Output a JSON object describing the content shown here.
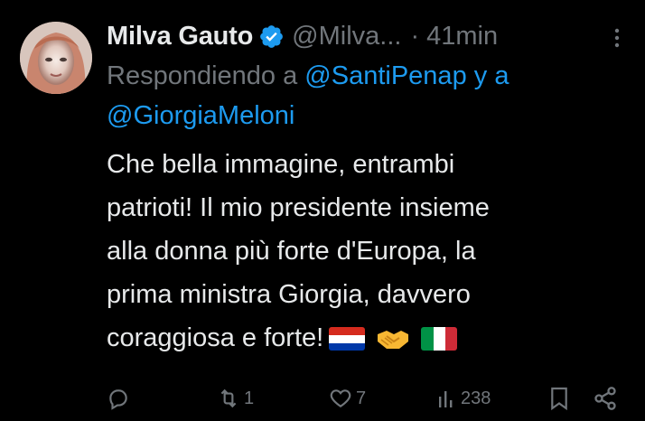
{
  "tweet": {
    "display_name": "Milva Gauto",
    "handle": "@Milva...",
    "separator": "·",
    "time": "41min",
    "replying_prefix": "Respondiendo a",
    "mention_1": "@SantiPenap",
    "replying_and": "y a",
    "mention_2": "@GiorgiaMeloni",
    "text": "Che bella immagine, entrambi\npatrioti! Il mio presidente insieme\nalla donna più forte d'Europa, la\nprima ministra Giorgia, davvero\ncoraggiosa e forte!",
    "emojis": [
      "flag-paraguay",
      "handshake",
      "flag-italy"
    ]
  },
  "actions": {
    "reply": {
      "icon": "reply-icon",
      "count": ""
    },
    "retweet": {
      "icon": "retweet-icon",
      "count": "1"
    },
    "like": {
      "icon": "heart-icon",
      "count": "7"
    },
    "views": {
      "icon": "views-icon",
      "count": "238"
    },
    "bookmark": {
      "icon": "bookmark-icon",
      "count": ""
    },
    "share": {
      "icon": "share-icon",
      "count": ""
    }
  },
  "colors": {
    "background": "#000000",
    "text": "#e7e9ea",
    "muted": "#71767b",
    "link": "#1d9bf0",
    "verified": "#1d9bf0"
  }
}
